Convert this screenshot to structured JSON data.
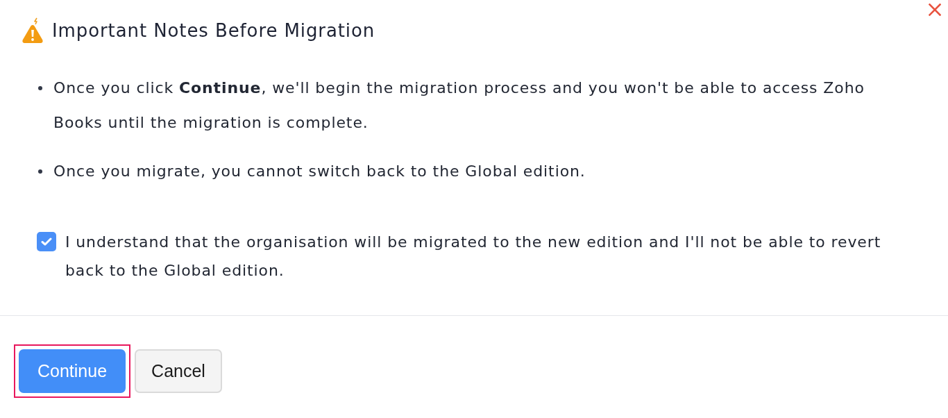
{
  "dialog": {
    "title": "Important Notes Before Migration"
  },
  "notes": [
    "Once you click **Continue**, we'll begin the migration process and you won't be able to access Zoho Books until the migration is complete.",
    "Once you migrate, you cannot switch back to the Global edition."
  ],
  "confirmation": {
    "label": "I understand that the organisation will be migrated to the new edition and I'll not be able to revert back to the Global edition.",
    "checked": true
  },
  "buttons": [
    {
      "label": "Continue",
      "kind": "primary",
      "highlighted": true
    },
    {
      "label": "Cancel",
      "kind": "secondary",
      "highlighted": false
    }
  ]
}
